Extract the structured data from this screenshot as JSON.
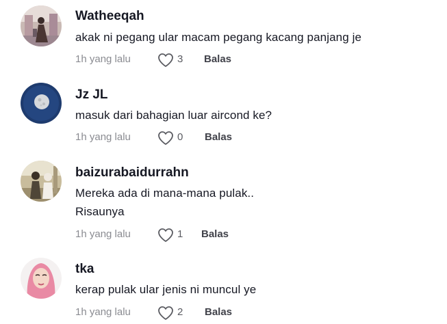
{
  "comments": [
    {
      "username": "Watheeqah",
      "lines": [
        "akak ni pegang ular macam pegang kacang panjang je"
      ],
      "time": "1h yang lalu",
      "likes": "3",
      "reply_label": "Balas",
      "avatar_icon": "photo-avatar-mosque"
    },
    {
      "username": "Jz JL",
      "lines": [
        "masuk dari bahagian luar aircond ke?"
      ],
      "time": "1h yang lalu",
      "likes": "0",
      "reply_label": "Balas",
      "avatar_icon": "moon-avatar"
    },
    {
      "username": "baizurabaidurrahn",
      "lines": [
        "Mereka ada di mana-mana pulak..",
        "Risaunya"
      ],
      "time": "1h yang lalu",
      "likes": "1",
      "reply_label": "Balas",
      "avatar_icon": "photo-avatar-couple"
    },
    {
      "username": "tka",
      "lines": [
        "kerap pulak ular jenis ni muncul ye"
      ],
      "time": "1h yang lalu",
      "likes": "2",
      "reply_label": "Balas",
      "avatar_icon": "hijab-girl-avatar"
    }
  ],
  "colors": {
    "text": "#161823",
    "meta": "#8a8b91",
    "reply": "#41424a"
  }
}
